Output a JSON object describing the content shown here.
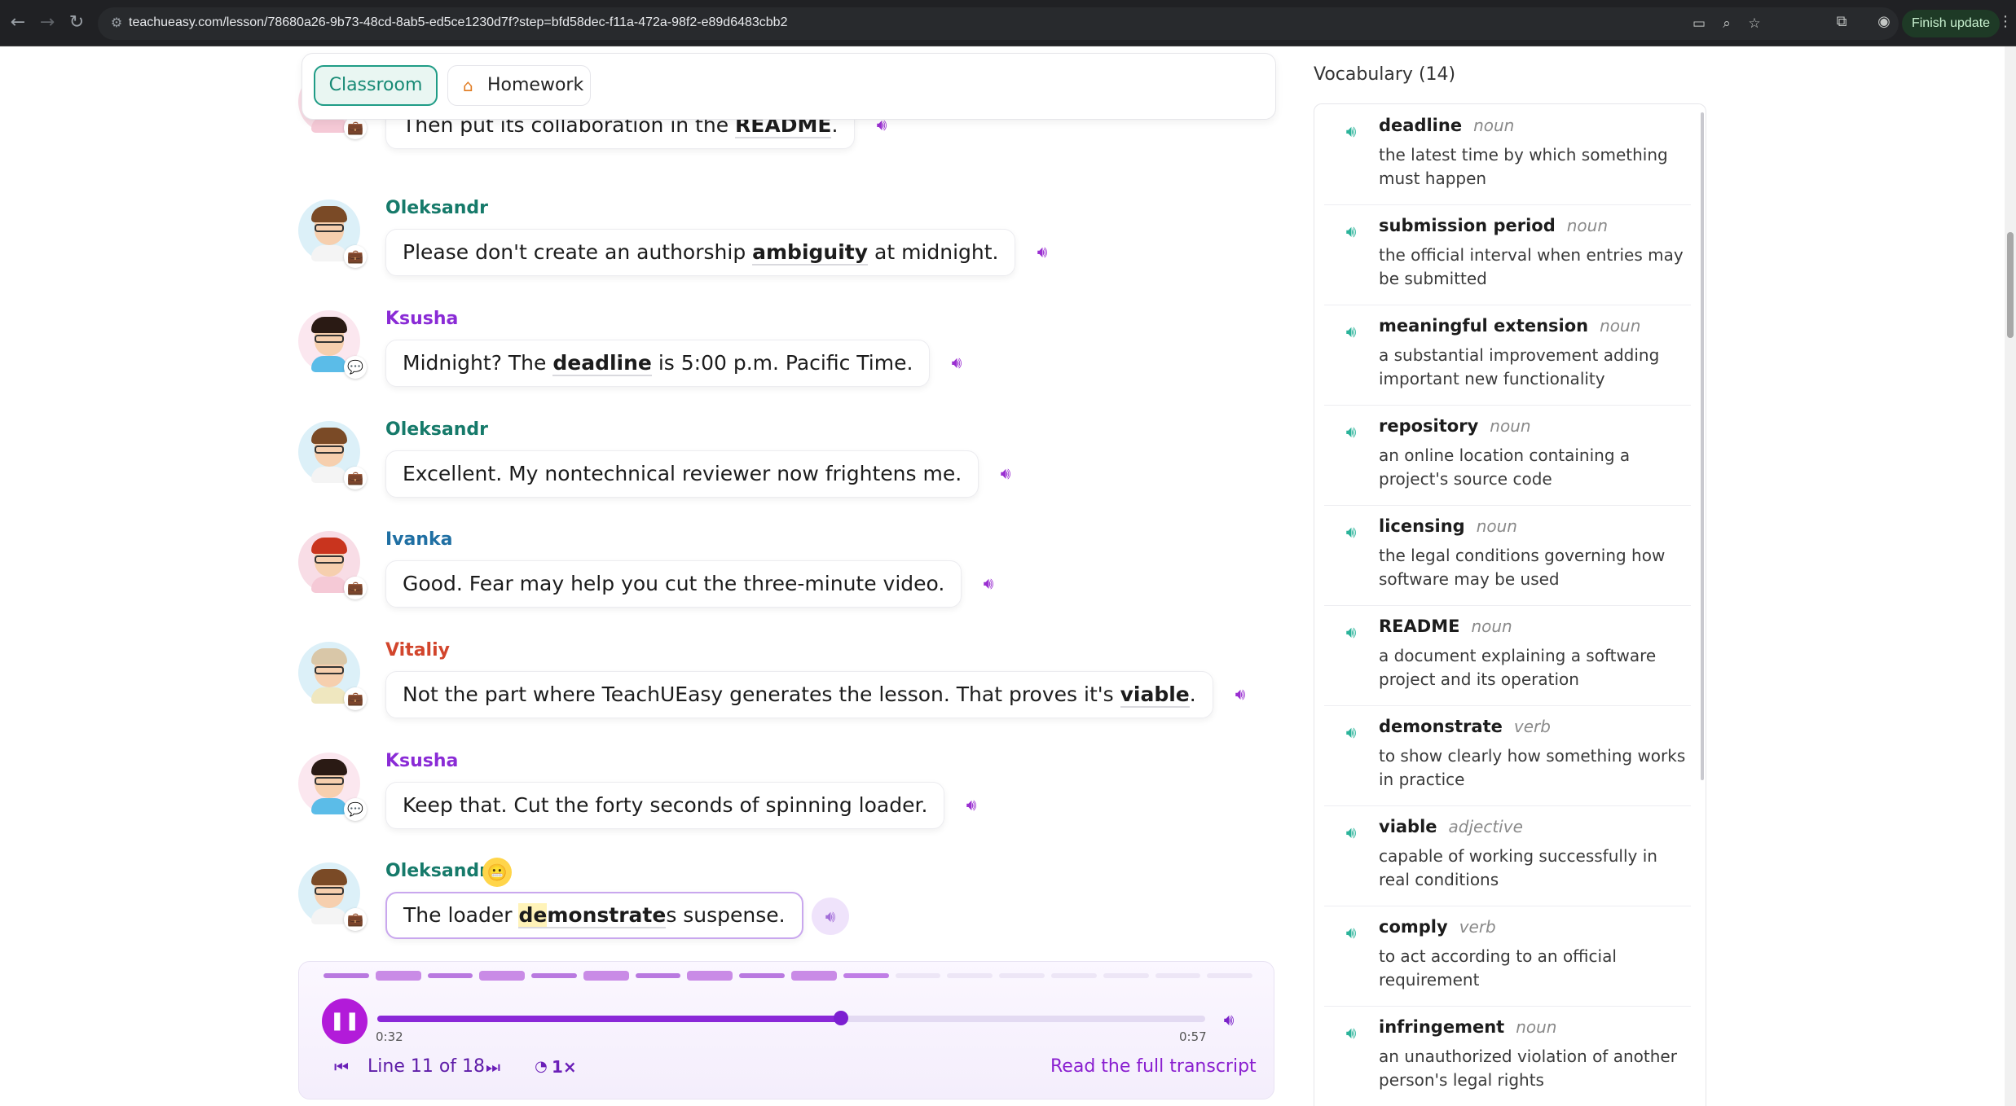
{
  "browser": {
    "url": "teachueasy.com/lesson/78680a26-9b73-48cd-8ab5-ed5ce1230d7f?step=bfd58dec-f11a-472a-98f2-e89d6483cbb2",
    "finish_update_label": "Finish update"
  },
  "tabs": {
    "classroom_label": "Classroom",
    "homework_label": "Homework"
  },
  "speakers": {
    "Oleksandr": {
      "name_color": "#167a6a",
      "body_color": "#f4f4f4",
      "bg": "#dcf0f8",
      "hair": "#7a4a26",
      "badge": "briefcase-icon"
    },
    "Ksusha": {
      "name_color": "#8a2bd6",
      "body_color": "#5bbce8",
      "bg": "#fbe7ef",
      "hair": "#2a1a14",
      "badge": "chat-bubble-icon"
    },
    "Ivanka": {
      "name_color": "#1f6fa3",
      "body_color": "#f5c9d6",
      "bg": "#f8dde6",
      "hair": "#c9341e",
      "badge": "briefcase-icon"
    },
    "Vitaliy": {
      "name_color": "#d2452c",
      "body_color": "#efe7bf",
      "bg": "#dcf0f8",
      "hair": "#d9c7a8",
      "badge": "briefcase-icon"
    }
  },
  "dialogue": [
    {
      "speaker": "",
      "avatar": "Ivanka",
      "parts": [
        {
          "t": "Then put its collaboration in the "
        },
        {
          "t": "README",
          "word": true
        },
        {
          "t": "."
        }
      ]
    },
    {
      "speaker": "Oleksandr",
      "avatar": "Oleksandr",
      "parts": [
        {
          "t": "Please don't create an authorship "
        },
        {
          "t": "ambiguity",
          "word": true
        },
        {
          "t": " at midnight."
        }
      ]
    },
    {
      "speaker": "Ksusha",
      "avatar": "Ksusha",
      "parts": [
        {
          "t": "Midnight? The "
        },
        {
          "t": "deadline",
          "word": true
        },
        {
          "t": " is 5:00 p.m. Pacific Time."
        }
      ]
    },
    {
      "speaker": "Oleksandr",
      "avatar": "Oleksandr",
      "parts": [
        {
          "t": "Excellent. My nontechnical reviewer now frightens me."
        }
      ]
    },
    {
      "speaker": "Ivanka",
      "avatar": "Ivanka",
      "parts": [
        {
          "t": "Good. Fear may help you cut the three-minute video."
        }
      ]
    },
    {
      "speaker": "Vitaliy",
      "avatar": "Vitaliy",
      "parts": [
        {
          "t": "Not the part where TeachUEasy generates the lesson. That proves it's "
        },
        {
          "t": "viable",
          "word": true
        },
        {
          "t": "."
        }
      ]
    },
    {
      "speaker": "Ksusha",
      "avatar": "Ksusha",
      "parts": [
        {
          "t": "Keep that. Cut the forty seconds of spinning loader."
        }
      ]
    },
    {
      "speaker": "Oleksandr",
      "avatar": "Oleksandr",
      "emoji": "😬",
      "active": true,
      "parts": [
        {
          "t": "The loader "
        },
        {
          "t": "de",
          "word": true,
          "hl": true
        },
        {
          "t": "monstrate",
          "word": true
        },
        {
          "t": "s suspense."
        }
      ]
    }
  ],
  "player": {
    "time_current": "0:32",
    "time_total": "0:57",
    "progress": 0.56,
    "line_label": "Line 11 of 18",
    "current_line": 11,
    "total_lines": 18,
    "speed_label": "1×",
    "transcript_link": "Read the full transcript",
    "accent": "#8a28d8"
  },
  "vocabulary": {
    "title": "Vocabulary (14)",
    "items": [
      {
        "term": "deadline",
        "pos": "noun",
        "definition": "the latest time by which something must happen"
      },
      {
        "term": "submission period",
        "pos": "noun",
        "definition": "the official interval when entries may be submitted"
      },
      {
        "term": "meaningful extension",
        "pos": "noun",
        "definition": "a substantial improvement adding important new functionality"
      },
      {
        "term": "repository",
        "pos": "noun",
        "definition": "an online location containing a project's source code"
      },
      {
        "term": "licensing",
        "pos": "noun",
        "definition": "the legal conditions governing how software may be used"
      },
      {
        "term": "README",
        "pos": "noun",
        "definition": "a document explaining a software project and its operation"
      },
      {
        "term": "demonstrate",
        "pos": "verb",
        "definition": "to show clearly how something works in practice"
      },
      {
        "term": "viable",
        "pos": "adjective",
        "definition": "capable of working successfully in real conditions"
      },
      {
        "term": "comply",
        "pos": "verb",
        "definition": "to act according to an official requirement"
      },
      {
        "term": "infringement",
        "pos": "noun",
        "definition": "an unauthorized violation of another person's legal rights"
      }
    ]
  }
}
